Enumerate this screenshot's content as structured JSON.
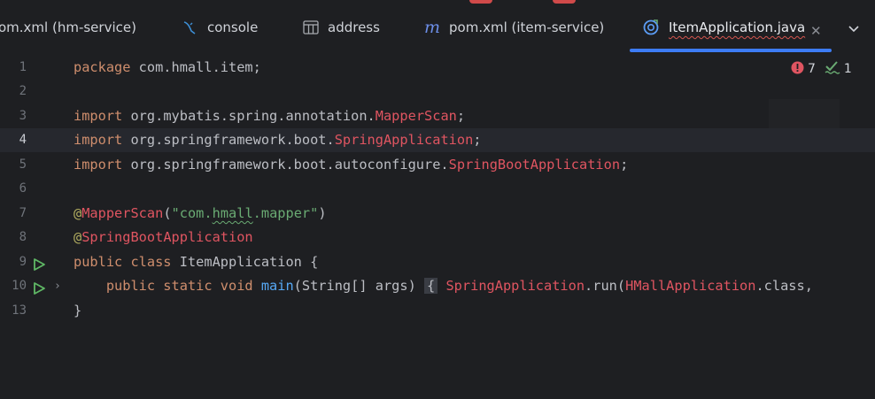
{
  "tabs": [
    {
      "label": "om.xml (hm-service)",
      "icon": "maven-icon"
    },
    {
      "label": "console",
      "icon": "database-console-icon"
    },
    {
      "label": "address",
      "icon": "table-icon"
    },
    {
      "label": "pom.xml (item-service)",
      "icon": "maven-icon"
    },
    {
      "label": "ItemApplication.java",
      "icon": "java-class-icon",
      "active": true
    }
  ],
  "inspections": {
    "errors": "7",
    "warnings": "1"
  },
  "lines": [
    {
      "num": "1"
    },
    {
      "num": "2"
    },
    {
      "num": "3"
    },
    {
      "num": "4"
    },
    {
      "num": "5"
    },
    {
      "num": "6"
    },
    {
      "num": "7"
    },
    {
      "num": "8"
    },
    {
      "num": "9"
    },
    {
      "num": "10"
    },
    {
      "num": "13"
    }
  ],
  "code": {
    "l1_kw": "package",
    "l1_rest": " com.hmall.item;",
    "l3_kw": "import",
    "l3_pkg": " org.mybatis.spring.annotation.",
    "l3_cls": "MapperScan",
    "l3_end": ";",
    "l4_kw": "import",
    "l4_pkg": " org.springframework.boot.",
    "l4_cls": "SpringApplication",
    "l4_end": ";",
    "l5_kw": "import",
    "l5_pkg": " org.springframework.boot.autoconfigure.",
    "l5_cls": "SpringBootApplication",
    "l5_end": ";",
    "l7_at": "@",
    "l7_ann": "MapperScan",
    "l7_open": "(",
    "l7_str1": "\"com.",
    "l7_str2": "hmall",
    "l7_str3": ".mapper\"",
    "l7_close": ")",
    "l8_at": "@",
    "l8_ann": "SpringBootApplication",
    "l9_kw": "public class",
    "l9_rest": " ItemApplication {",
    "l10_kw": "    public static void",
    "l10_fn": " main",
    "l10_args": "(String[] args)",
    "l10_brace": "{",
    "l10_cls": " SpringApplication",
    "l10_call": ".run(",
    "l10_arg": "HMallApplication",
    "l10_tail": ".class,",
    "l13": "}"
  },
  "colors": {
    "accent": "#3d7cf5",
    "error": "#e05561",
    "ok": "#6aab73"
  }
}
